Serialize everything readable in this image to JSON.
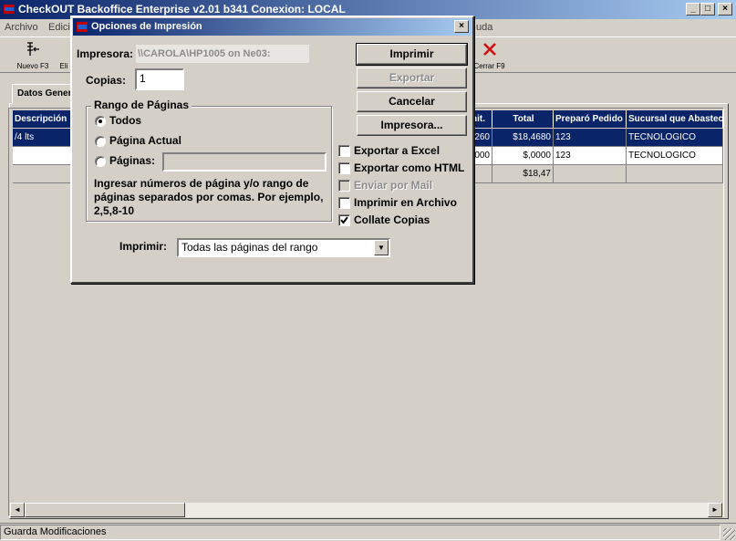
{
  "window": {
    "title": "CheckOUT Backoffice Enterprise v2.01 b341 Conexion: LOCAL",
    "min": "_",
    "max": "□",
    "close": "×"
  },
  "menu": {
    "items": [
      "Archivo",
      "Edici",
      "uda"
    ]
  },
  "toolbar": {
    "nuevo": "Nuevo F3",
    "eliminar": "Eli",
    "cerrar": "Cerrar F9"
  },
  "tabs": {
    "datos_generales": "Datos Genera"
  },
  "grid": {
    "columns": [
      "Descripción",
      "nit.",
      "Total",
      "Preparó Pedido",
      "Sucursal que Abastece"
    ],
    "rows": [
      {
        "descripcion": "/4 lts",
        "unit": "260",
        "total": "$18,4680",
        "preparo": "123",
        "sucursal": "TECNOLOGICO"
      },
      {
        "descripcion": "",
        "unit": "000",
        "total": "$,0000",
        "preparo": "123",
        "sucursal": "TECNOLOGICO"
      }
    ],
    "sum_total": "$18,47"
  },
  "status": {
    "text": "Guarda Modificaciones"
  },
  "dialog": {
    "title": "Opciones de Impresión",
    "close": "×",
    "printer_label": "Impresora:",
    "printer_value": "\\\\CAROLA\\HP1005 on Ne03:",
    "copies_label": "Copias:",
    "copies_value": "1",
    "range_title": "Rango de Páginas",
    "radio_todos": "Todos",
    "radio_actual": "Página Actual",
    "radio_paginas": "Páginas:",
    "help": "Ingresar números de página y/o rango de páginas separados por comas. Por ejemplo, 2,5,8-10",
    "print_label": "Imprimir:",
    "print_value": "Todas las páginas del rango",
    "buttons": {
      "imprimir": "Imprimir",
      "exportar": "Exportar",
      "cancelar": "Cancelar",
      "impresora": "Impresora..."
    },
    "checks": {
      "excel": "Exportar a Excel",
      "html": "Exportar como HTML",
      "mail": "Enviar por Mail",
      "archivo": "Imprimir en Archivo",
      "collate": "Collate Copias"
    },
    "state": {
      "range": "todos",
      "excel": false,
      "html": false,
      "mail": false,
      "archivo": false,
      "collate": true
    }
  }
}
